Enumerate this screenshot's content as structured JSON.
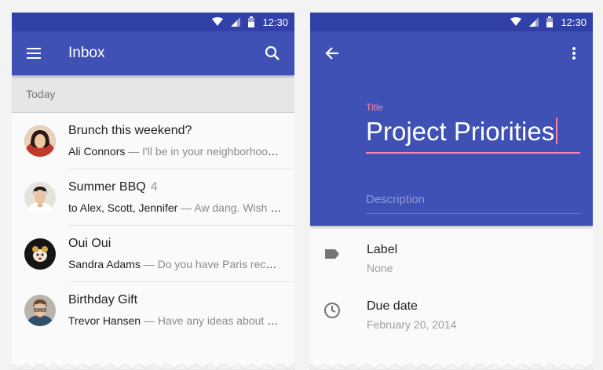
{
  "status_bar": {
    "time": "12:30"
  },
  "inbox": {
    "title": "Inbox",
    "section": "Today",
    "emails": [
      {
        "subject": "Brunch this weekend?",
        "count": "",
        "sender": "Ali Connors",
        "preview": " — I'll be in your neighborhood doing errands this weekend",
        "avatar_color": "#c98a5e"
      },
      {
        "subject": "Summer BBQ",
        "count": "4",
        "sender": "to Alex, Scott, Jennifer",
        "preview": " — Aw dang. Wish I could make it",
        "avatar_color": "#d8c7b2"
      },
      {
        "subject": "Oui Oui",
        "count": "",
        "sender": "Sandra Adams",
        "preview": " — Do you have Paris recommendations?",
        "avatar_color": "#2b2b2b"
      },
      {
        "subject": "Birthday Gift",
        "count": "",
        "sender": "Trevor Hansen",
        "preview": " — Have any ideas about what we should get",
        "avatar_color": "#8d7b6a"
      }
    ]
  },
  "task": {
    "title_label": "Title",
    "title_value": "Project Priorities",
    "description_placeholder": "Description",
    "fields": [
      {
        "label": "Label",
        "value": "None",
        "icon": "label-icon"
      },
      {
        "label": "Due date",
        "value": "February 20, 2014",
        "icon": "clock-icon"
      }
    ]
  },
  "colors": {
    "primary": "#3f51b5",
    "primary_dark": "#3241a8",
    "accent": "#ff80ab"
  }
}
